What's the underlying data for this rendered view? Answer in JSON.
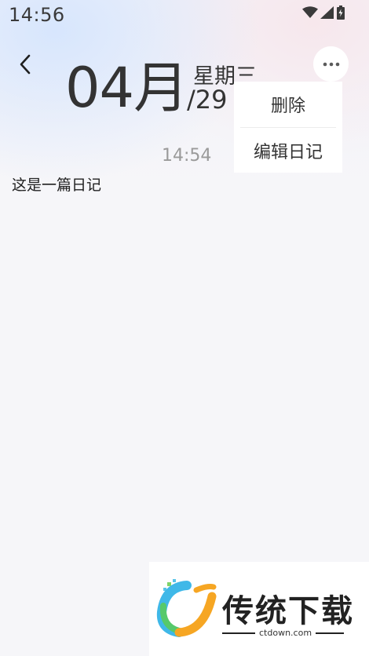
{
  "status_bar": {
    "time": "14:56"
  },
  "header": {
    "month": "04月",
    "weekday": "星期三",
    "day": "/29"
  },
  "menu": {
    "items": [
      "删除",
      "编辑日记"
    ]
  },
  "entry": {
    "time": "14:54",
    "text": "这是一篇日记"
  },
  "watermark": {
    "brand": "传统下载",
    "site": "ctdown.com"
  },
  "colors": {
    "text_primary": "#333333",
    "text_secondary": "#9a9a9a",
    "background": "#f6f6f9"
  }
}
